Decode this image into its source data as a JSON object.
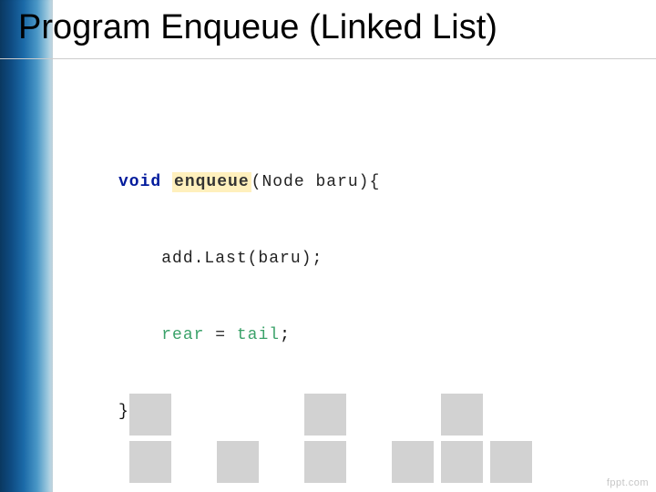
{
  "title": "Program Enqueue (Linked List)",
  "code": {
    "keyword_void": "void",
    "fn_name": "enqueue",
    "fn_params": "(Node baru){",
    "line2_call": "add.Last(baru);",
    "line3_lhs": "rear",
    "line3_op": " = ",
    "line3_rhs": "tail",
    "line3_semicolon": ";",
    "line4": "}"
  },
  "watermark": "fppt.com"
}
